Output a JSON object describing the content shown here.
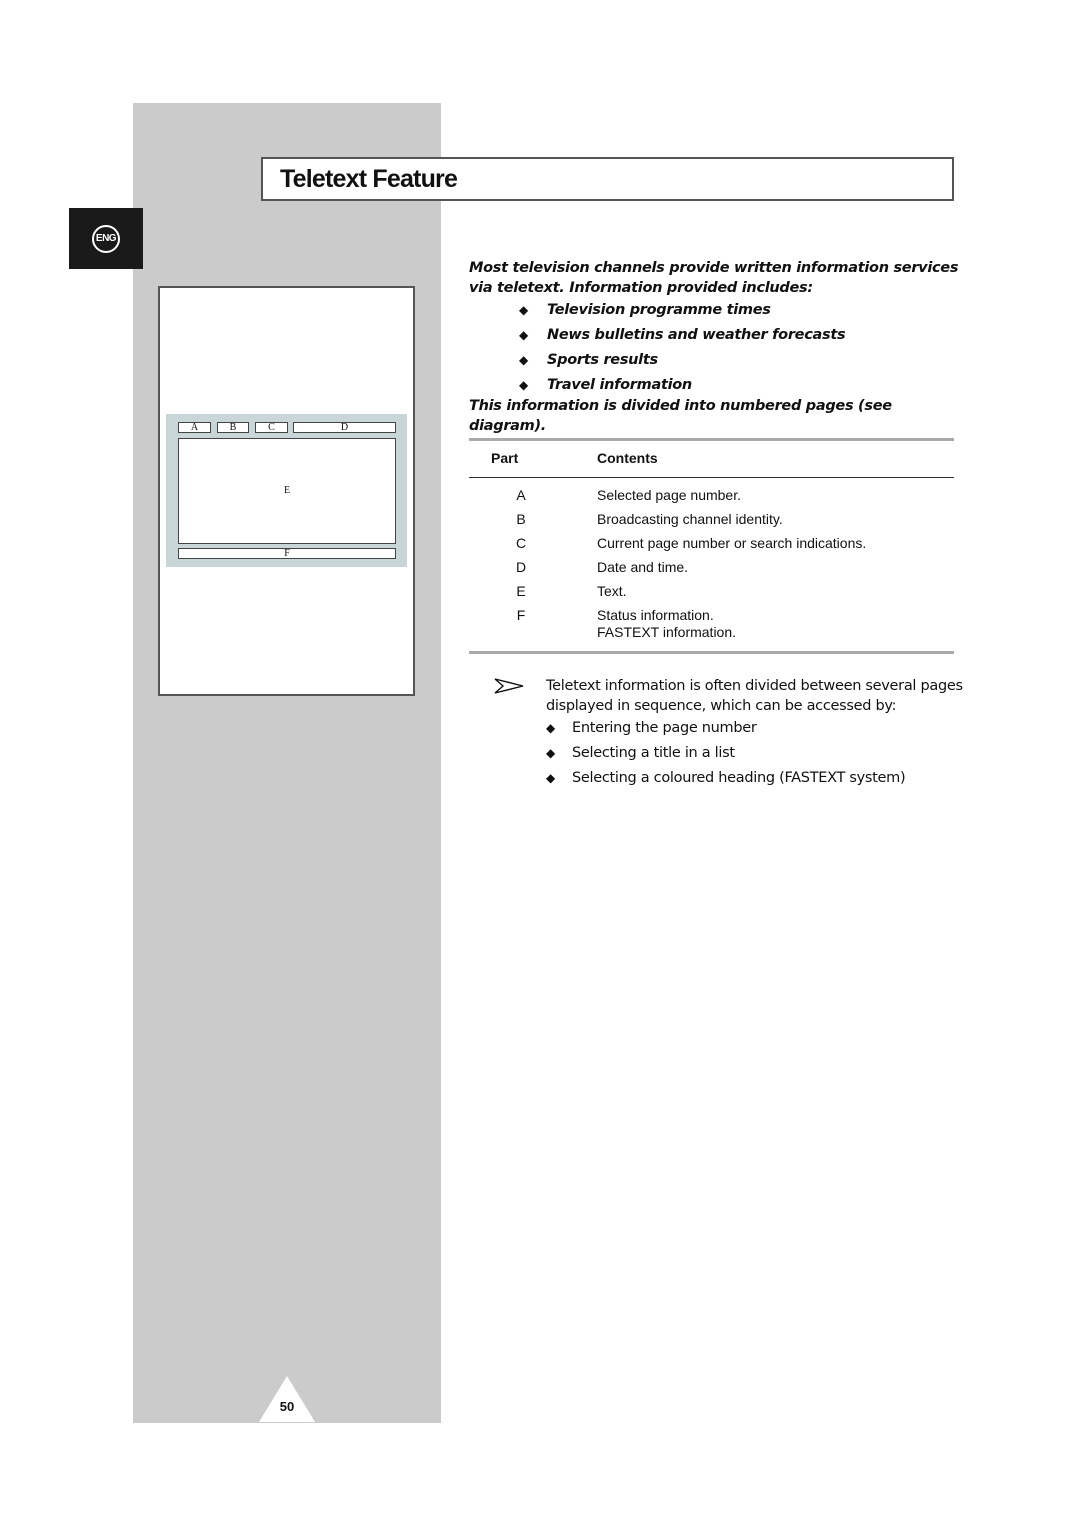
{
  "page": {
    "title": "Teletext Feature",
    "language_badge": "ENG",
    "page_number": "50"
  },
  "diagram": {
    "cells": {
      "a": "A",
      "b": "B",
      "c": "C",
      "d": "D",
      "e": "E",
      "f": "F"
    },
    "colors": {
      "screen_background": "#c8d6d8"
    }
  },
  "intro": {
    "paragraph": "Most television channels provide written information services via teletext. Information provided includes:",
    "bullets": [
      "Television programme times",
      "News bulletins and weather forecasts",
      "Sports results",
      "Travel information"
    ],
    "closing": "This information is divided into numbered pages (see diagram)."
  },
  "table": {
    "headers": {
      "part": "Part",
      "contents": "Contents"
    },
    "rows": [
      {
        "part": "A",
        "contents": "Selected page number."
      },
      {
        "part": "B",
        "contents": "Broadcasting channel identity."
      },
      {
        "part": "C",
        "contents": "Current page number or search indications."
      },
      {
        "part": "D",
        "contents": "Date and time."
      },
      {
        "part": "E",
        "contents": "Text."
      },
      {
        "part": "F",
        "contents": "Status information.",
        "contents_line2": "FASTEXT information."
      }
    ]
  },
  "note": {
    "text": "Teletext information is often divided between several pages displayed in sequence, which can be accessed by:",
    "bullets": [
      "Entering the page number",
      "Selecting a title in a list",
      "Selecting a coloured heading (FASTEXT system)"
    ]
  },
  "icons": {
    "diamond": "◆"
  }
}
